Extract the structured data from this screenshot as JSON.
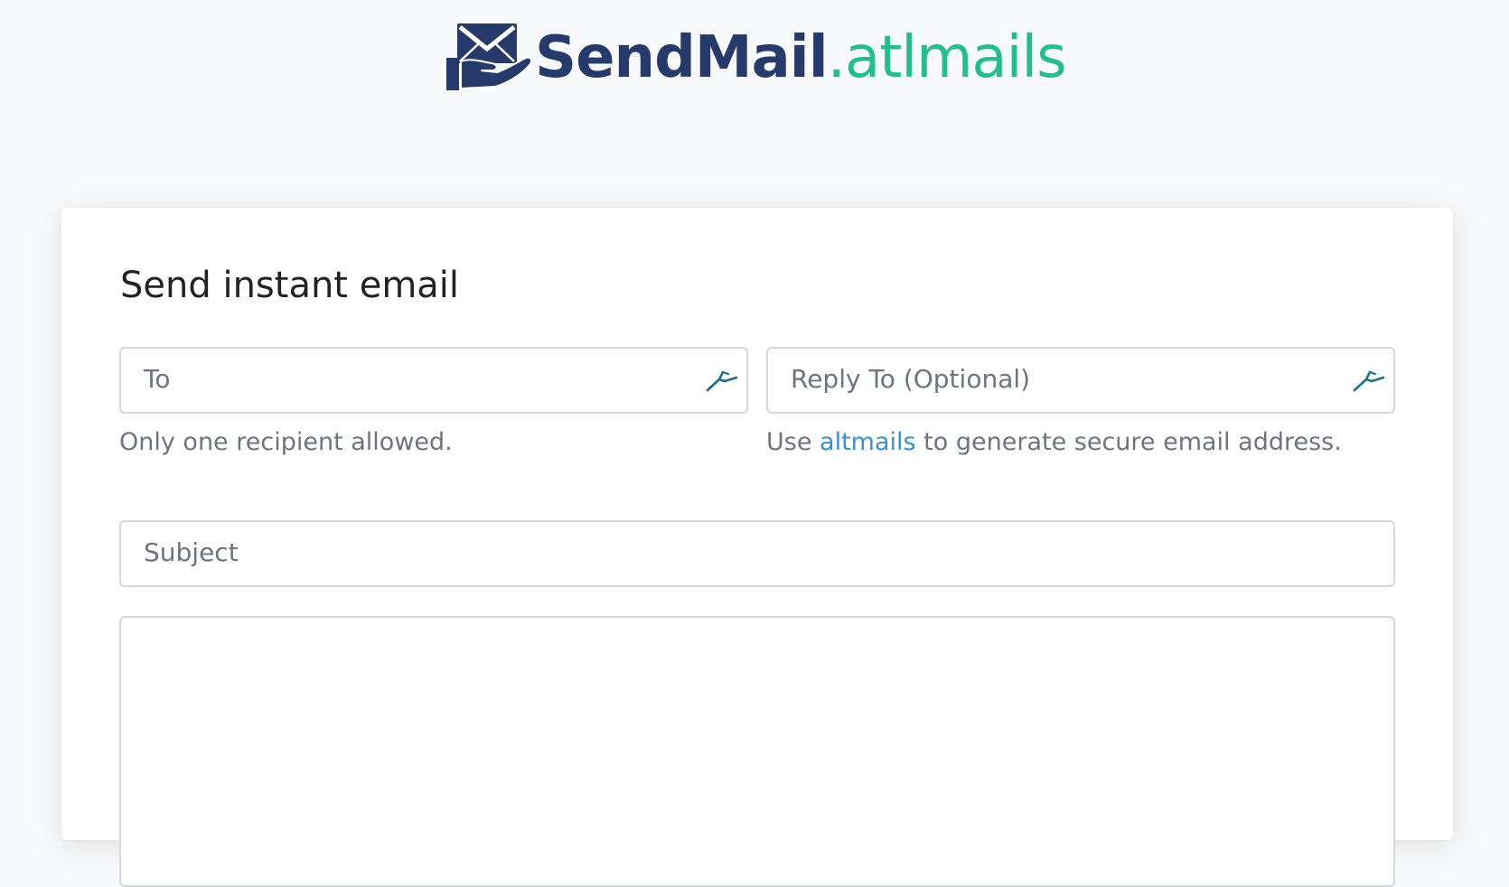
{
  "brand": {
    "name_primary": "SendMail",
    "name_secondary": ".atlmails",
    "logo_icon": "envelope-hand-icon",
    "color_primary": "#263a6b",
    "color_secondary": "#22bf8e"
  },
  "form": {
    "title": "Send instant email",
    "to": {
      "placeholder": "To",
      "value": "",
      "icon": "autofill-arrow-icon",
      "help": "Only one recipient allowed."
    },
    "reply_to": {
      "placeholder": "Reply To (Optional)",
      "value": "",
      "icon": "autofill-arrow-icon",
      "help_prefix": "Use ",
      "help_link": "altmails",
      "help_suffix": " to generate secure email address."
    },
    "subject": {
      "placeholder": "Subject",
      "value": ""
    },
    "body": {
      "placeholder": "",
      "value": ""
    }
  },
  "colors": {
    "link": "#3a8fd1",
    "page_background": "#f8f9fb",
    "muted_text": "#6c757d"
  }
}
